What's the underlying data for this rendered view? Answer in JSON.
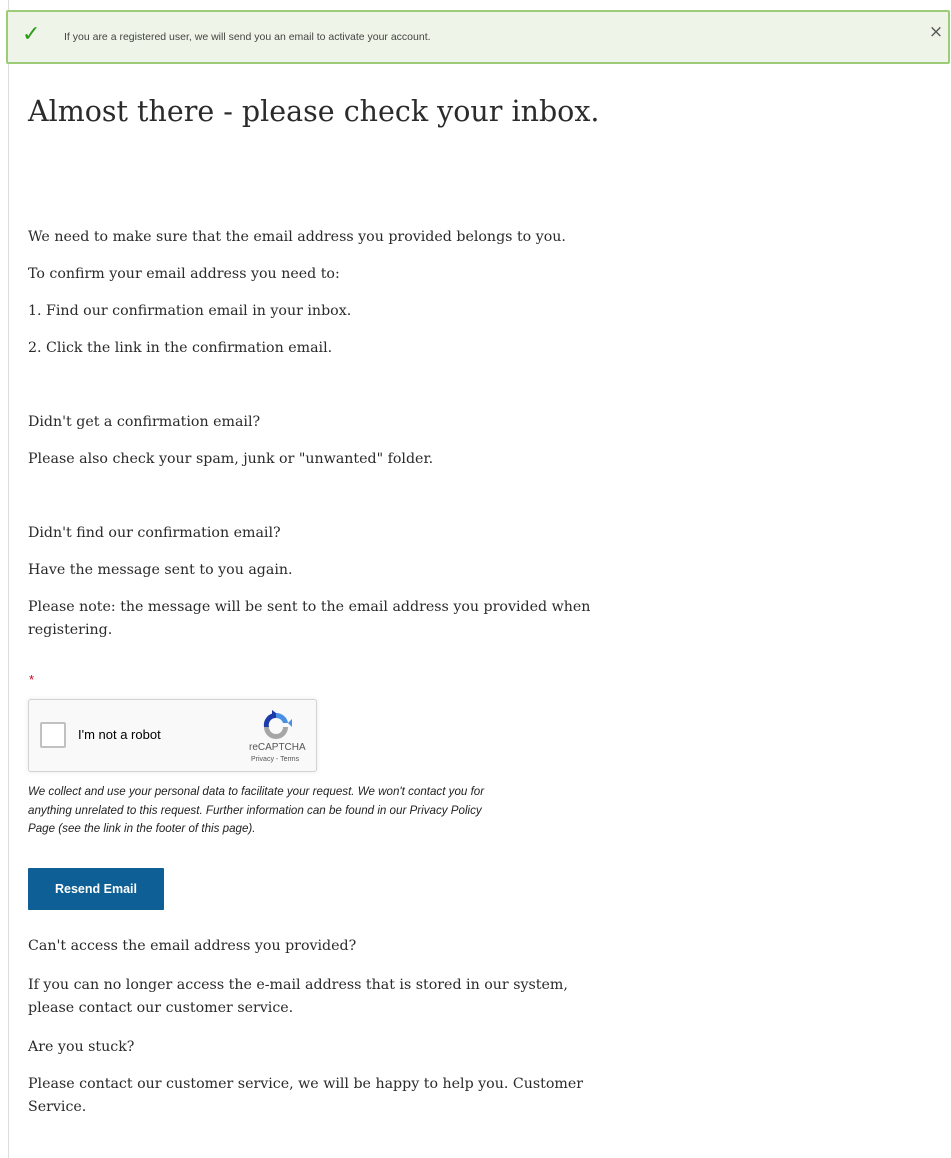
{
  "alert": {
    "icon": "check-icon",
    "message": "If you are a registered user, we will send you an email to activate your account.",
    "close_label": "×"
  },
  "heading": "Almost there - please check your inbox.",
  "intro": {
    "line1": "We need to make sure that the email address you provided belongs to you.",
    "line2": "To confirm your email address you need to:",
    "step1": "1. Find our confirmation email in your inbox.",
    "step2": "2. Click the link in the confirmation email."
  },
  "no_email": {
    "question": "Didn't get a confirmation email?",
    "advice": "Please also check your spam, junk or \"unwanted\" folder."
  },
  "resend_section": {
    "question": "Didn't find our confirmation email?",
    "advice": "Have the message sent to you again.",
    "note_line1": "Please note: the message will be sent to the email address you provided when",
    "note_line2": "registering."
  },
  "required_marker": "*",
  "captcha": {
    "label": "I'm not a robot",
    "brand": "reCAPTCHA",
    "privacy": "Privacy",
    "separator": " - ",
    "terms": "Terms"
  },
  "privacy_note": {
    "line1": "We collect and use your personal data to facilitate your request. We won't contact you for",
    "line2": "anything unrelated to this request. Further information can be found in our Privacy Policy",
    "line3": "Page (see the link in the footer of this page)."
  },
  "resend_button": "Resend Email",
  "access": {
    "question": "Can't access the email address you provided?",
    "advice_line1": "If you can no longer access the e-mail address that is stored in our system,",
    "advice_line2": "please contact our customer service."
  },
  "stuck": {
    "question": "Are you stuck?",
    "advice_line1": "Please contact our customer service, we will be happy to help you. Customer",
    "advice_line2": "Service."
  },
  "colors": {
    "alert_bg": "#eef5e8",
    "alert_border": "#9ccc78",
    "check": "#2e9a1a",
    "button": "#0d5f95",
    "required": "#d0021b"
  }
}
